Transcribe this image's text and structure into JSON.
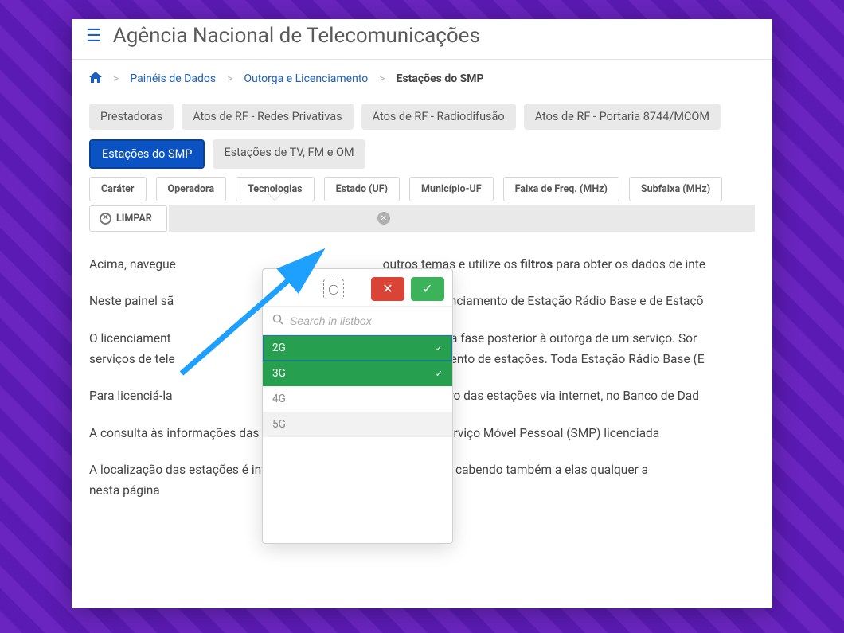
{
  "header": {
    "title": "Agência Nacional de Telecomunicações"
  },
  "breadcrumb": {
    "home_icon": "home",
    "sep": ">",
    "items": [
      {
        "label": "Painéis de Dados",
        "link": true
      },
      {
        "label": "Outorga e Licenciamento",
        "link": true
      },
      {
        "label": "Estações do SMP",
        "link": false
      }
    ]
  },
  "chips": [
    {
      "label": "Prestadoras",
      "active": false
    },
    {
      "label": "Atos de RF - Redes Privativas",
      "active": false
    },
    {
      "label": "Atos de RF - Radiodifusão",
      "active": false
    },
    {
      "label": "Atos de RF - Portaria 8744/MCOM",
      "active": false
    },
    {
      "label": "Estações do SMP",
      "active": true
    },
    {
      "label": "Estações de TV, FM e OM",
      "active": false
    }
  ],
  "filters": [
    {
      "label": "Caráter"
    },
    {
      "label": "Operadora"
    },
    {
      "label": "Tecnologias"
    },
    {
      "label": "Estado (UF)"
    },
    {
      "label": "Município-UF"
    },
    {
      "label": "Faixa de Freq. (MHz)"
    },
    {
      "label": "Subfaixa (MHz)"
    }
  ],
  "actions": {
    "clear_label": "LIMPAR"
  },
  "dropdown": {
    "search_placeholder": "Search in listbox",
    "items": [
      {
        "label": "2G",
        "selected": true
      },
      {
        "label": "3G",
        "selected": true
      },
      {
        "label": "4G",
        "selected": false
      },
      {
        "label": "5G",
        "selected": false
      }
    ]
  },
  "body": {
    "p1a": "Acima, navegue",
    "p1b": "outros temas e utilize os ",
    "p1c": "filtros",
    "p1d": " para obter os dados de inte",
    "p2a": "Neste painel sã",
    "p2b": "entes ao licenciamento de Estação Rádio Base e de Estaçõ",
    "p3a": "O licenciament",
    "p3b": "icações é uma fase posterior à outorga de um serviço. Sor",
    "p3c": "serviços de tele",
    "p3d": "r o licenciamento de estações. Toda Estação Rádio Base (E",
    "p4a": "Para licenciá-la",
    "p4b": "er um cadastro das estações via internet, no Banco de Dad",
    "p5": "A consulta às informações das Estações Rádio Base (ERB's) do Serviço Móvel Pessoal (SMP) licenciada",
    "p6": "A localização das estações é informada pelas operadoras do SMP, cabendo também a elas qualquer a",
    "p7": "nesta página"
  },
  "colors": {
    "accent_blue": "#0b53c2",
    "link_blue": "#1c5fbf",
    "green": "#269f4e",
    "bg_purple": "#5b1ab3",
    "arrow_blue": "#1ea0ff"
  }
}
